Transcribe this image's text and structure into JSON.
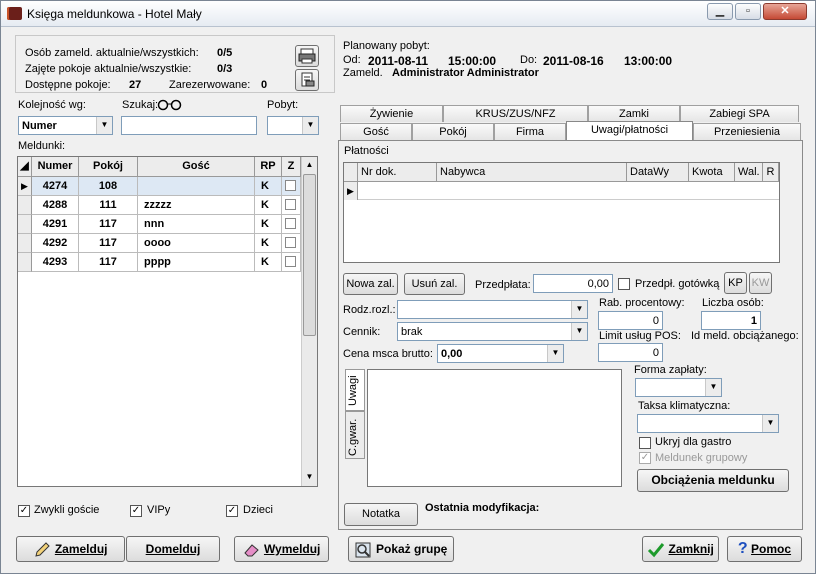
{
  "window": {
    "title": "Księga meldunkowa - Hotel Mały",
    "min": "0",
    "max": "1",
    "close": "X"
  },
  "stats": {
    "guests_label": "Osób zameld. aktualnie/wszystkich:",
    "guests_value": "0/5",
    "rooms_label": "Zajęte pokoje aktualnie/wszystkie:",
    "rooms_value": "0/3",
    "free_label": "Dostępne pokoje:",
    "free_value": "27",
    "reserved_label": "Zarezerwowane:",
    "reserved_value": "0"
  },
  "stay": {
    "title": "Planowany pobyt:",
    "from_label": "Od:",
    "from_date": "2011-08-11",
    "from_time": "15:00:00",
    "to_label": "Do:",
    "to_date": "2011-08-16",
    "to_time": "13:00:00",
    "by_label": "Zameld.",
    "by_value": "Administrator Administrator"
  },
  "filters": {
    "order_label": "Kolejność wg:",
    "order_value": "Numer",
    "search_label": "Szukaj:",
    "search_value": "",
    "stay_label": "Pobyt:",
    "stay_value": ""
  },
  "list": {
    "label": "Meldunki:",
    "columns": [
      "Numer",
      "Pokój",
      "Gość",
      "RP",
      "Z"
    ],
    "rows": [
      {
        "numer": "4274",
        "pokoj": "108",
        "gosc": "",
        "rp": "K"
      },
      {
        "numer": "4288",
        "pokoj": "111",
        "gosc": "zzzzz",
        "rp": "K"
      },
      {
        "numer": "4291",
        "pokoj": "117",
        "gosc": "nnn",
        "rp": "K"
      },
      {
        "numer": "4292",
        "pokoj": "117",
        "gosc": "oooo",
        "rp": "K"
      },
      {
        "numer": "4293",
        "pokoj": "117",
        "gosc": "pppp",
        "rp": "K"
      }
    ]
  },
  "checks": {
    "regular": "Zwykli goście",
    "vip": "VIPy",
    "kids": "Dzieci"
  },
  "tabs_top": [
    "Żywienie",
    "KRUS/ZUS/NFZ",
    "Zamki",
    "Zabiegi SPA"
  ],
  "tabs_bottom": [
    "Gość",
    "Pokój",
    "Firma",
    "Uwagi/płatności",
    "Przeniesienia"
  ],
  "payments": {
    "label": "Płatności",
    "columns": [
      "Nr dok.",
      "Nabywca",
      "DataWy",
      "Kwota",
      "Wal.",
      "R"
    ],
    "new_btn": "Nowa zal.",
    "del_btn": "Usuń zal.",
    "prepay_label": "Przedpłata:",
    "prepay_value": "0,00",
    "cash_label": "Przedpł. gotówką",
    "kp": "KP",
    "kw": "KW"
  },
  "form": {
    "rodz_label": "Rodz.rozl.:",
    "rodz_value": "",
    "cennik_label": "Cennik:",
    "cennik_value": "brak",
    "cena_label": "Cena msca brutto:",
    "cena_value": "0,00",
    "rab_label": "Rab. procentowy:",
    "rab_value": "0",
    "osob_label": "Liczba osób:",
    "osob_value": "1",
    "limit_label": "Limit usług POS:",
    "limit_value": "0",
    "idmeld_label": "Id meld. obciążanego:"
  },
  "notes": {
    "tab_uwagi": "Uwagi",
    "tab_gwar": "C.gwar."
  },
  "payment_form": {
    "label": "Forma zapłaty:",
    "value": ""
  },
  "climate": {
    "label": "Taksa klimatyczna:",
    "value": ""
  },
  "hide_gastro": "Ukryj dla gastro",
  "group": "Meldunek grupowy",
  "charges_btn": "Obciążenia meldunku",
  "notatka_btn": "Notatka",
  "last_mod": "Ostatnia modyfikacja:",
  "bottom": {
    "zamelduj": "Zamelduj",
    "domelduj": "Domelduj",
    "wymelduj": "Wymelduj",
    "pokaz": "Pokaż grupę",
    "zamknij": "Zamknij",
    "pomoc": "Pomoc"
  }
}
